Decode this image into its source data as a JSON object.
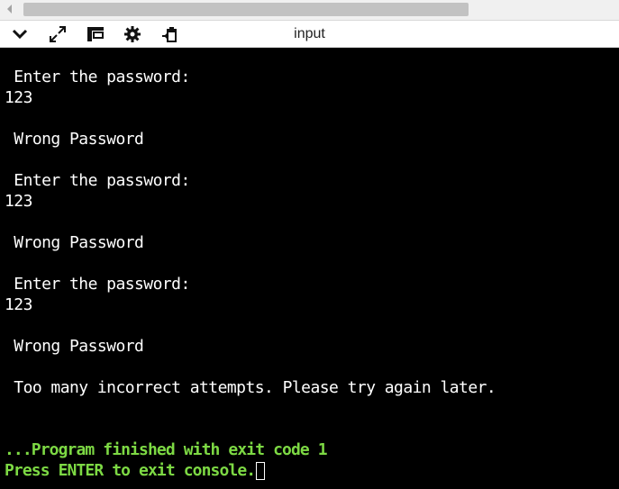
{
  "toolbar": {
    "title": "input",
    "icons": [
      "chevron-down-icon",
      "expand-icon",
      "layout-icon",
      "gear-icon",
      "clipboard-icon"
    ]
  },
  "console": {
    "lines": [
      " Enter the password:",
      "123",
      "",
      " Wrong Password",
      "",
      " Enter the password:",
      "123",
      "",
      " Wrong Password",
      "",
      " Enter the password:",
      "123",
      "",
      " Wrong Password",
      "",
      " Too many incorrect attempts. Please try again later.",
      "",
      "",
      "...Program finished with exit code 1",
      "Press ENTER to exit console."
    ]
  },
  "colors": {
    "console_bg": "#000000",
    "console_text": "#ffffff",
    "status_text": "#7dd944"
  }
}
